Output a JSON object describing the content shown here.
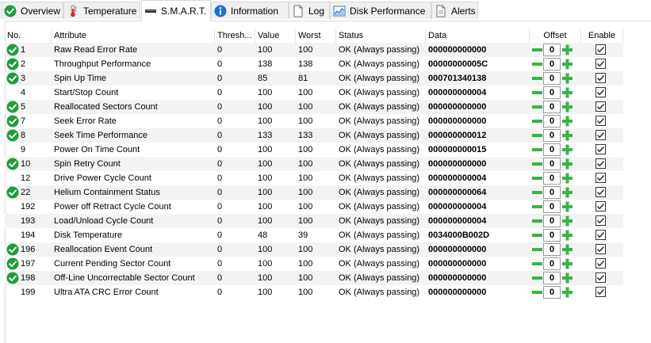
{
  "tabs": [
    {
      "label": "Overview",
      "icon": "check-circle-icon"
    },
    {
      "label": "Temperature",
      "icon": "thermometer-icon"
    },
    {
      "label": "S.M.A.R.T.",
      "icon": "drive-icon"
    },
    {
      "label": "Information",
      "icon": "info-icon"
    },
    {
      "label": "Log",
      "icon": "document-icon"
    },
    {
      "label": "Disk Performance",
      "icon": "performance-chart-icon"
    },
    {
      "label": "Alerts",
      "icon": "alert-document-icon"
    }
  ],
  "active_tab": "S.M.A.R.T.",
  "columns": {
    "no": "No.",
    "attribute": "Attribute",
    "threshold": "Thresh...",
    "value": "Value",
    "worst": "Worst",
    "status": "Status",
    "data": "Data",
    "offset": "Offset",
    "enable": "Enable"
  },
  "colors": {
    "ok_green": "#1e9e3a",
    "plus_minus_green": "#37b34a",
    "alt_row": "#f3f3f3"
  },
  "rows": [
    {
      "no": "1",
      "attribute": "Raw Read Error Rate",
      "threshold": "0",
      "value": "100",
      "worst": "100",
      "status": "OK (Always passing)",
      "data": "000000000000",
      "offset": "0",
      "ok_icon": true,
      "enabled": true
    },
    {
      "no": "2",
      "attribute": "Throughput Performance",
      "threshold": "0",
      "value": "138",
      "worst": "138",
      "status": "OK (Always passing)",
      "data": "00000000005C",
      "offset": "0",
      "ok_icon": true,
      "enabled": true
    },
    {
      "no": "3",
      "attribute": "Spin Up Time",
      "threshold": "0",
      "value": "85",
      "worst": "81",
      "status": "OK (Always passing)",
      "data": "000701340138",
      "offset": "0",
      "ok_icon": true,
      "enabled": true
    },
    {
      "no": "4",
      "attribute": "Start/Stop Count",
      "threshold": "0",
      "value": "100",
      "worst": "100",
      "status": "OK (Always passing)",
      "data": "000000000004",
      "offset": "0",
      "ok_icon": false,
      "enabled": true
    },
    {
      "no": "5",
      "attribute": "Reallocated Sectors Count",
      "threshold": "0",
      "value": "100",
      "worst": "100",
      "status": "OK (Always passing)",
      "data": "000000000000",
      "offset": "0",
      "ok_icon": true,
      "enabled": true
    },
    {
      "no": "7",
      "attribute": "Seek Error Rate",
      "threshold": "0",
      "value": "100",
      "worst": "100",
      "status": "OK (Always passing)",
      "data": "000000000000",
      "offset": "0",
      "ok_icon": true,
      "enabled": true
    },
    {
      "no": "8",
      "attribute": "Seek Time Performance",
      "threshold": "0",
      "value": "133",
      "worst": "133",
      "status": "OK (Always passing)",
      "data": "000000000012",
      "offset": "0",
      "ok_icon": true,
      "enabled": true
    },
    {
      "no": "9",
      "attribute": "Power On Time Count",
      "threshold": "0",
      "value": "100",
      "worst": "100",
      "status": "OK (Always passing)",
      "data": "000000000015",
      "offset": "0",
      "ok_icon": false,
      "enabled": true
    },
    {
      "no": "10",
      "attribute": "Spin Retry Count",
      "threshold": "0",
      "value": "100",
      "worst": "100",
      "status": "OK (Always passing)",
      "data": "000000000000",
      "offset": "0",
      "ok_icon": true,
      "enabled": true
    },
    {
      "no": "12",
      "attribute": "Drive Power Cycle Count",
      "threshold": "0",
      "value": "100",
      "worst": "100",
      "status": "OK (Always passing)",
      "data": "000000000004",
      "offset": "0",
      "ok_icon": false,
      "enabled": true
    },
    {
      "no": "22",
      "attribute": "Helium Containment Status",
      "threshold": "0",
      "value": "100",
      "worst": "100",
      "status": "OK (Always passing)",
      "data": "000000000064",
      "offset": "0",
      "ok_icon": true,
      "enabled": true
    },
    {
      "no": "192",
      "attribute": "Power off Retract Cycle Count",
      "threshold": "0",
      "value": "100",
      "worst": "100",
      "status": "OK (Always passing)",
      "data": "000000000004",
      "offset": "0",
      "ok_icon": false,
      "enabled": true
    },
    {
      "no": "193",
      "attribute": "Load/Unload Cycle Count",
      "threshold": "0",
      "value": "100",
      "worst": "100",
      "status": "OK (Always passing)",
      "data": "000000000004",
      "offset": "0",
      "ok_icon": false,
      "enabled": true
    },
    {
      "no": "194",
      "attribute": "Disk Temperature",
      "threshold": "0",
      "value": "48",
      "worst": "39",
      "status": "OK (Always passing)",
      "data": "0034000B002D",
      "offset": "0",
      "ok_icon": false,
      "enabled": true
    },
    {
      "no": "196",
      "attribute": "Reallocation Event Count",
      "threshold": "0",
      "value": "100",
      "worst": "100",
      "status": "OK (Always passing)",
      "data": "000000000000",
      "offset": "0",
      "ok_icon": true,
      "enabled": true
    },
    {
      "no": "197",
      "attribute": "Current Pending Sector Count",
      "threshold": "0",
      "value": "100",
      "worst": "100",
      "status": "OK (Always passing)",
      "data": "000000000000",
      "offset": "0",
      "ok_icon": true,
      "enabled": true
    },
    {
      "no": "198",
      "attribute": "Off-Line Uncorrectable Sector Count",
      "threshold": "0",
      "value": "100",
      "worst": "100",
      "status": "OK (Always passing)",
      "data": "000000000000",
      "offset": "0",
      "ok_icon": true,
      "enabled": true
    },
    {
      "no": "199",
      "attribute": "Ultra ATA CRC Error Count",
      "threshold": "0",
      "value": "100",
      "worst": "100",
      "status": "OK (Always passing)",
      "data": "000000000000",
      "offset": "0",
      "ok_icon": false,
      "enabled": true
    }
  ]
}
